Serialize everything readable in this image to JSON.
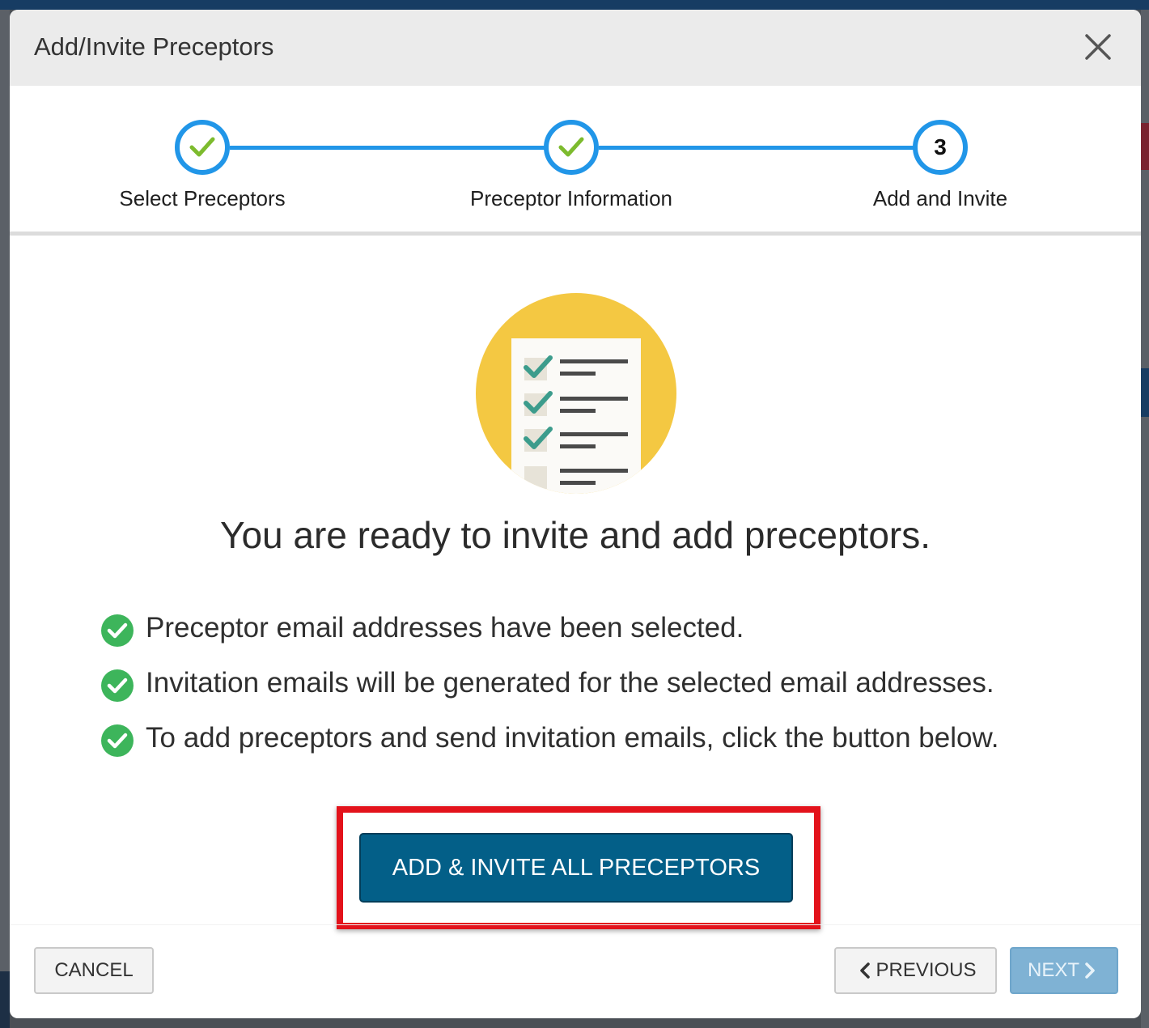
{
  "dialog": {
    "title": "Add/Invite Preceptors",
    "close_icon": "close-icon"
  },
  "stepper": {
    "steps": [
      {
        "label": "Select Preceptors",
        "status": "complete",
        "icon": "check-icon"
      },
      {
        "label": "Preceptor Information",
        "status": "complete",
        "icon": "check-icon"
      },
      {
        "label": "Add and Invite",
        "status": "current",
        "number": "3"
      }
    ],
    "accent_color": "#2196e8",
    "check_color": "#7dbb2e"
  },
  "content": {
    "illustration": "checklist-illustration",
    "headline": "You are ready to invite and add preceptors.",
    "checklist": [
      "Preceptor email addresses have been selected.",
      "Invitation emails will be generated for the selected email addresses.",
      "To add preceptors and send invitation emails, click the button below."
    ],
    "check_color": "#3db55b",
    "primary_button": "ADD & INVITE ALL PRECEPTORS",
    "primary_color": "#035f88",
    "highlight_color": "#e3121b"
  },
  "footer": {
    "cancel": "CANCEL",
    "previous": "PREVIOUS",
    "next": "NEXT"
  }
}
